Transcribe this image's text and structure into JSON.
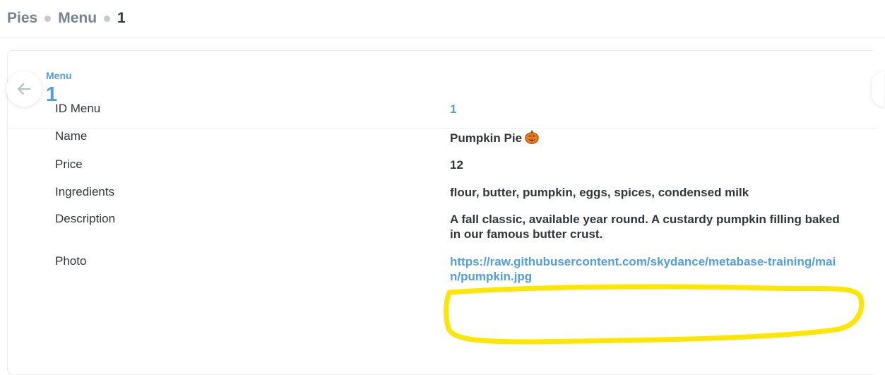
{
  "breadcrumb": {
    "items": [
      "Pies",
      "Menu",
      "1"
    ]
  },
  "header": {
    "table_label": "Menu",
    "record_id": "1",
    "back_icon": "arrow-left-icon"
  },
  "fields": [
    {
      "label": "ID Menu",
      "value": "1",
      "type": "link"
    },
    {
      "label": "Name",
      "value": "Pumpkin Pie",
      "icon": "jack-o-lantern-icon"
    },
    {
      "label": "Price",
      "value": "12"
    },
    {
      "label": "Ingredients",
      "value": "flour, butter, pumpkin, eggs, spices, condensed milk"
    },
    {
      "label": "Description",
      "value": "A fall classic, available year round. A custardy pumpkin filling baked in our famous butter crust."
    },
    {
      "label": "Photo",
      "value": "https://raw.githubusercontent.com/skydance/metabase-training/main/pumpkin.jpg",
      "type": "link"
    }
  ],
  "colors": {
    "brand": "#509ee3",
    "highlight": "#ffe600",
    "text": "#2e353b"
  }
}
